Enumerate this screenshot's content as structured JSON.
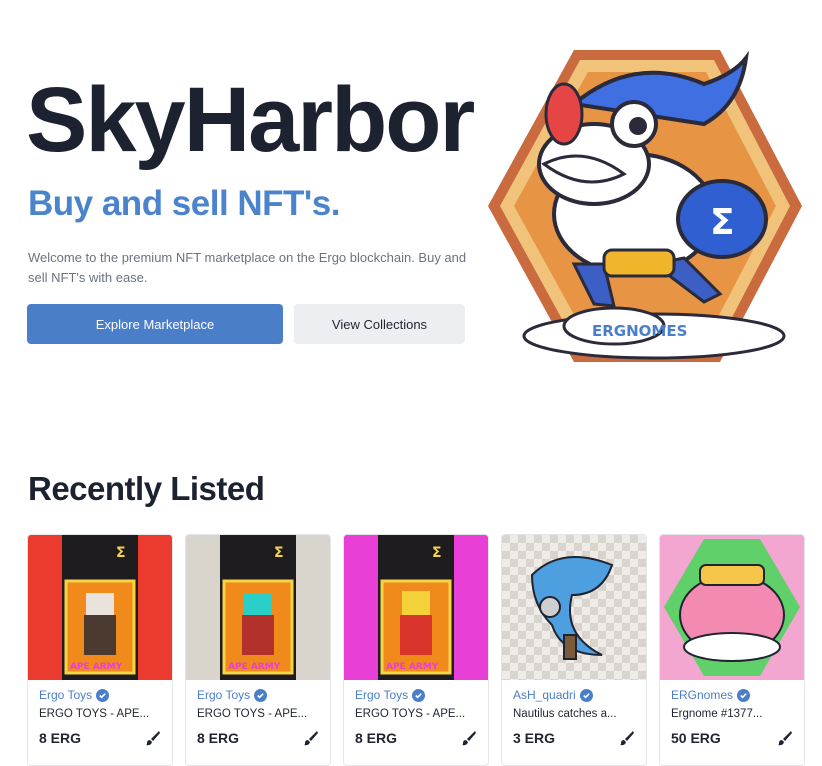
{
  "hero": {
    "title": "SkyHarbor",
    "subtitle": "Buy and sell NFT's.",
    "description": "Welcome to the premium NFT marketplace on the Ergo blockchain. Buy and sell NFT's with ease.",
    "explore_label": "Explore Marketplace",
    "collections_label": "View Collections",
    "image_label": "ERGNOMES"
  },
  "recent": {
    "title": "Recently Listed",
    "cards": [
      {
        "collection": "Ergo Toys",
        "name": "ERGO TOYS - APE...",
        "price": "8 ERG",
        "bg": "#ea3b2e",
        "image_label": "APE ARMY"
      },
      {
        "collection": "Ergo Toys",
        "name": "ERGO TOYS - APE...",
        "price": "8 ERG",
        "bg": "#d9d4cc",
        "image_label": "APE ARMY"
      },
      {
        "collection": "Ergo Toys",
        "name": "ERGO TOYS - APE...",
        "price": "8 ERG",
        "bg": "#e83fd6",
        "image_label": "APE ARMY"
      },
      {
        "collection": "AsH_quadri",
        "name": "Nautilus catches a...",
        "price": "3 ERG",
        "bg": "#e6e1dc"
      },
      {
        "collection": "ERGnomes",
        "name": "Ergnome #1377...",
        "price": "50 ERG",
        "bg": "#f3a6cf"
      }
    ]
  },
  "colors": {
    "accent": "#4a7ec9",
    "heading": "#1d2230",
    "secondary_button": "#eceef2"
  }
}
